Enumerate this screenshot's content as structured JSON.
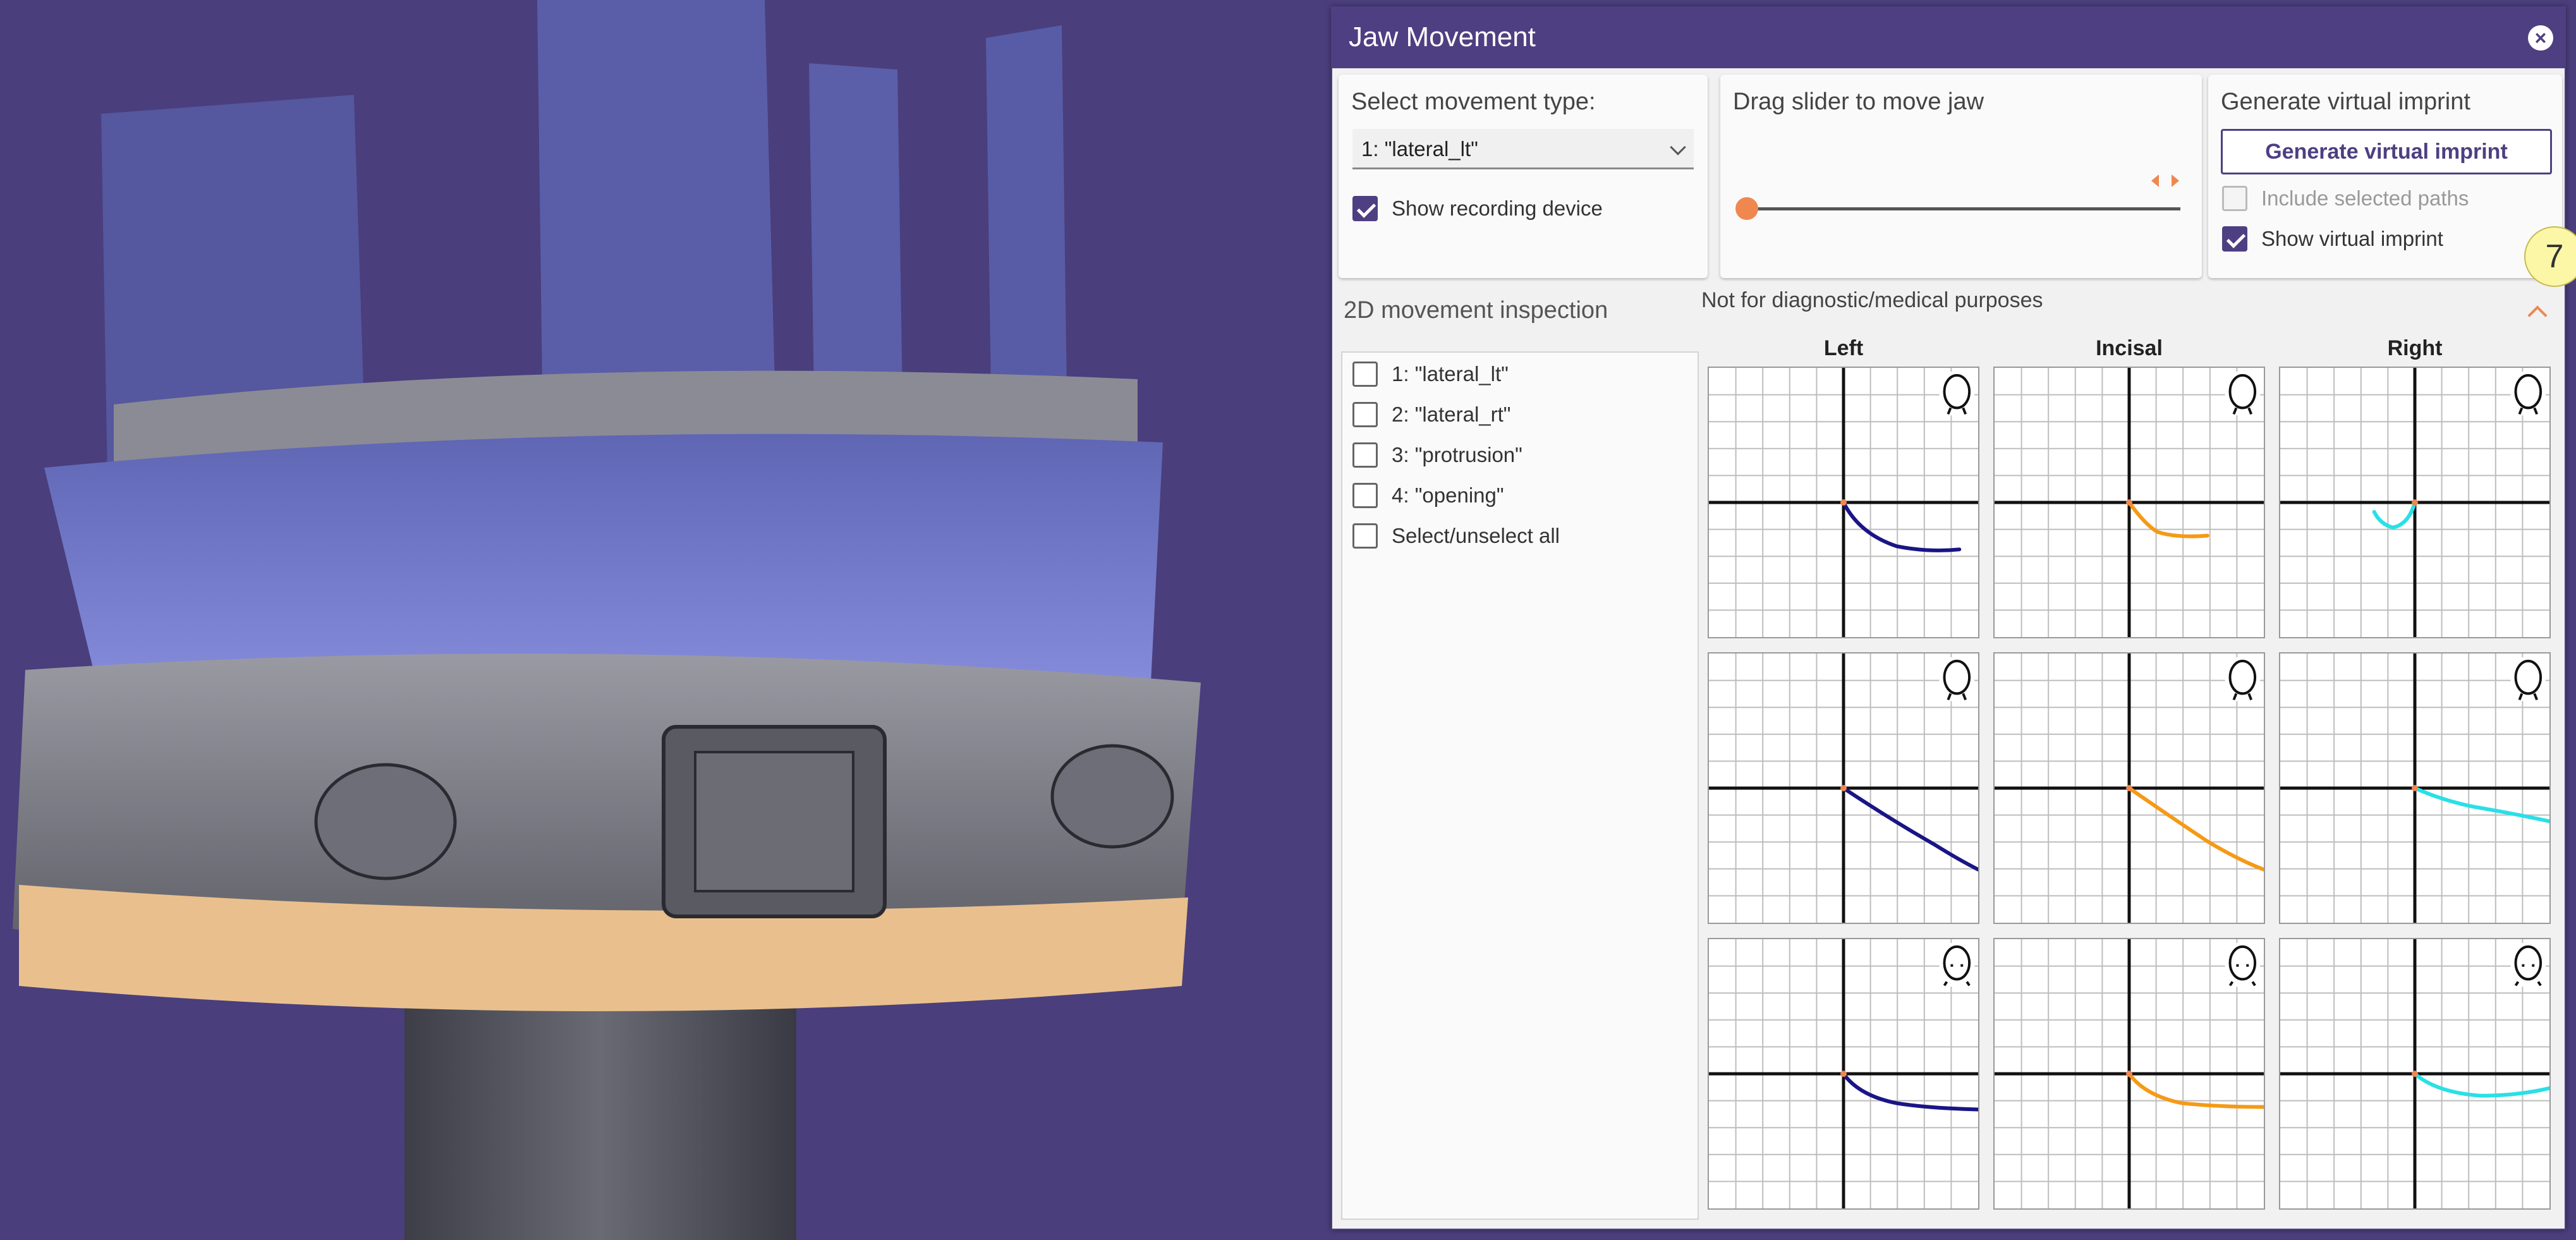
{
  "panel": {
    "title": "Jaw Movement",
    "close_icon": "close-icon"
  },
  "movement": {
    "label": "Select movement type:",
    "selected": "1: \"lateral_lt\"",
    "show_recording_device": "Show recording device",
    "show_recording_device_checked": true
  },
  "slider": {
    "label": "Drag slider to move jaw",
    "value": 0
  },
  "imprint": {
    "label": "Generate virtual imprint",
    "button": "Generate virtual imprint",
    "include_selected_paths": "Include selected paths",
    "include_selected_paths_checked": false,
    "include_selected_paths_disabled": true,
    "show_virtual_imprint": "Show virtual imprint",
    "show_virtual_imprint_checked": true
  },
  "step_badge": "7",
  "inspection": {
    "title": "2D movement inspection",
    "disclaimer": "Not for diagnostic/medical purposes",
    "paths": [
      {
        "label": "1: \"lateral_lt\"",
        "checked": false
      },
      {
        "label": "2: \"lateral_rt\"",
        "checked": false
      },
      {
        "label": "3: \"protrusion\"",
        "checked": false
      },
      {
        "label": "4: \"opening\"",
        "checked": false
      },
      {
        "label": "Select/unselect all",
        "checked": false
      }
    ],
    "columns": [
      "Left",
      "Incisal",
      "Right"
    ],
    "column_colors": [
      "#1a1585",
      "#f59a16",
      "#29e0e6"
    ],
    "view_icons": [
      "head-side-view-icon",
      "head-top-view-icon",
      "head-front-view-icon"
    ]
  },
  "colors": {
    "accent": "#4e3f82",
    "slider": "#f0874f",
    "viewport_bg": "#4a3e7c"
  }
}
